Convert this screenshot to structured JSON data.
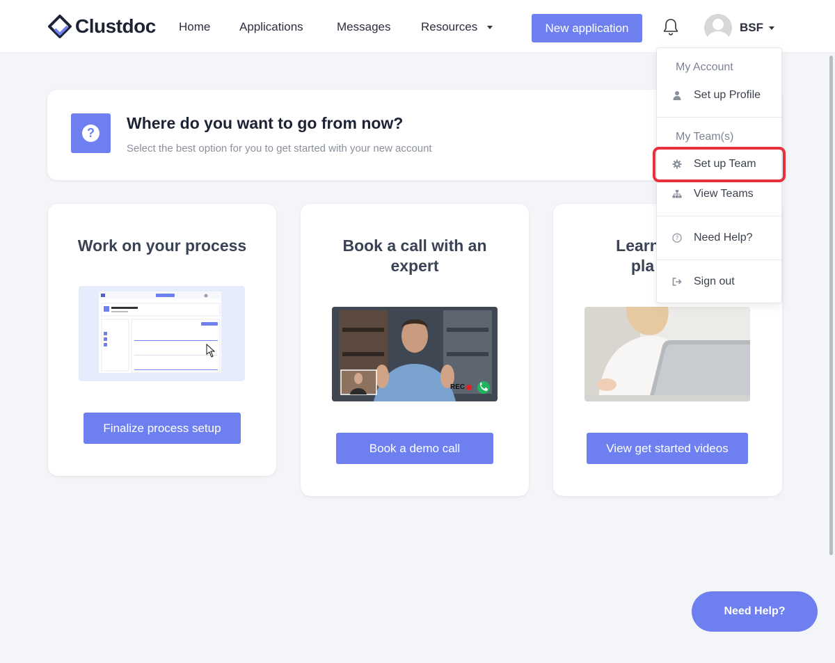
{
  "app": {
    "name": "Clustdoc"
  },
  "nav": {
    "home": "Home",
    "applications": "Applications",
    "messages": "Messages",
    "resources": "Resources",
    "new_application": "New application",
    "user_initials": "BSF"
  },
  "hero": {
    "title": "Where do you want to go from now?",
    "subtitle": "Select the best option for you to get started with your new account",
    "icon": "question-icon"
  },
  "cards": [
    {
      "title": "Work on your process",
      "button": "Finalize process setup",
      "image": "process-preview"
    },
    {
      "title_line1": "Book a call with an",
      "title_line2": "expert",
      "button": "Book a demo call",
      "image": "video-call-photo"
    },
    {
      "title_line1": "Learn t",
      "title_line2": "pla",
      "button": "View get started videos",
      "image": "laptop-woman-photo"
    }
  ],
  "dropdown": {
    "my_account_header": "My Account",
    "setup_profile": "Set up Profile",
    "my_teams_header": "My Team(s)",
    "setup_team": "Set up Team",
    "view_teams": "View Teams",
    "need_help": "Need Help?",
    "sign_out": "Sign out"
  },
  "float_help": "Need Help?",
  "colors": {
    "accent": "#6e7ff0",
    "highlight": "#e8303f",
    "background": "#f4f5f9"
  }
}
